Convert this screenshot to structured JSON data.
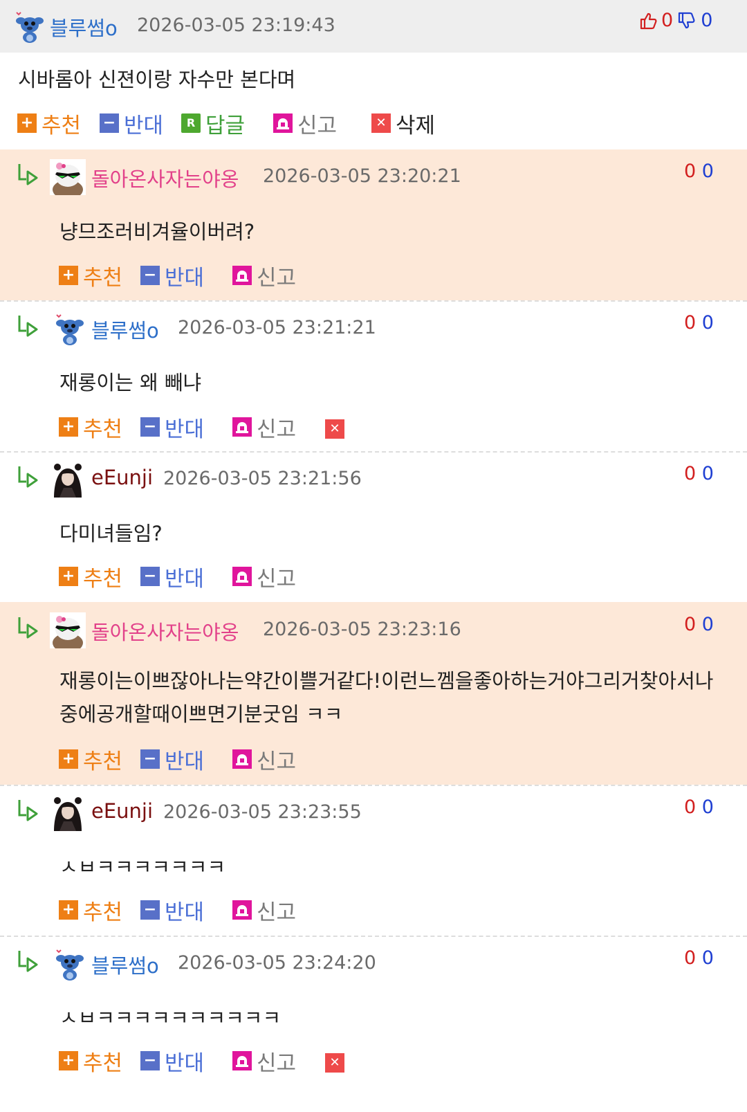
{
  "post": {
    "author": "블루썸o",
    "time": "2026-03-05 23:19:43",
    "likes": "0",
    "dislikes": "0",
    "text": "시바롬아 신젼이랑 자수만 본다며",
    "actions": {
      "recommend": "추천",
      "oppose": "반대",
      "reply": "답글",
      "report": "신고",
      "delete": "삭제"
    }
  },
  "comments": [
    {
      "author": "돌아온사자는야옹",
      "time": "2026-03-05 23:20:21",
      "up": "0",
      "down": "0",
      "text": "냥므조러비겨율이버려?",
      "recommend": "추천",
      "oppose": "반대",
      "report": "신고"
    },
    {
      "author": "블루썸o",
      "time": "2026-03-05 23:21:21",
      "up": "0",
      "down": "0",
      "text": "재롱이는 왜 빼냐",
      "recommend": "추천",
      "oppose": "반대",
      "report": "신고"
    },
    {
      "author": "eEunji",
      "time": "2026-03-05 23:21:56",
      "up": "0",
      "down": "0",
      "text": "다미녀들임?",
      "recommend": "추천",
      "oppose": "반대",
      "report": "신고"
    },
    {
      "author": "돌아온사자는야옹",
      "time": "2026-03-05 23:23:16",
      "up": "0",
      "down": "0",
      "text": "재롱이는이쁘잖아나는약간이쁠거같다!이런느껨을좋아하는거야그리거찾아서나중에공개할때이쁘면기분굿임 ㅋㅋ",
      "recommend": "추천",
      "oppose": "반대",
      "report": "신고"
    },
    {
      "author": "eEunji",
      "time": "2026-03-05 23:23:55",
      "up": "0",
      "down": "0",
      "text": "ㅅㅂㅋㅋㅋㅋㅋㅋㅋ",
      "recommend": "추천",
      "oppose": "반대",
      "report": "신고"
    },
    {
      "author": "블루썸o",
      "time": "2026-03-05 23:24:20",
      "up": "0",
      "down": "0",
      "text": "ㅅㅂㅋㅋㅋㅋㅋㅋㅋㅋㅋㅋ",
      "recommend": "추천",
      "oppose": "반대",
      "report": "신고"
    }
  ],
  "icons": {
    "thumb_up": "thumb-up-icon",
    "thumb_down": "thumb-down-icon",
    "reply_arrow": "reply-arrow-icon",
    "recommend": "plus-icon",
    "oppose": "minus-icon",
    "reply": "reply-icon",
    "report": "siren-icon",
    "delete": "close-icon"
  },
  "colors": {
    "header_bg": "#eeeeee",
    "highlight_bg": "#fde8d8",
    "nick_blue": "#2d6fc9",
    "nick_pink": "#e2418a",
    "nick_dark": "#7a1010",
    "recommend": "#ee7f15",
    "oppose": "#4b6fd6",
    "reply": "#3fa03a",
    "report": "#e0159c",
    "delete": "#ee4a4a"
  }
}
